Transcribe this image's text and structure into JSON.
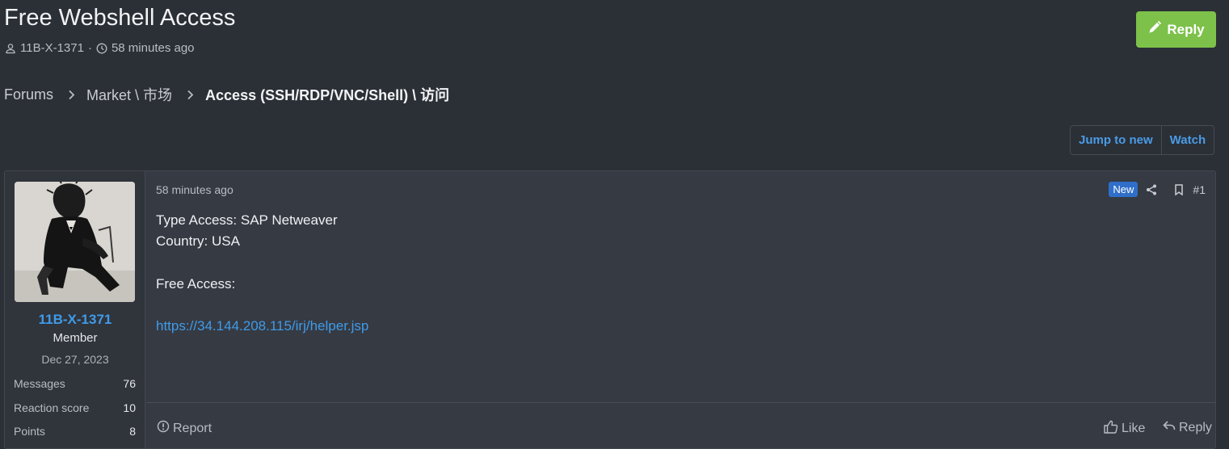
{
  "thread": {
    "title": "Free Webshell Access",
    "author": "11B-X-1371",
    "separator": "·",
    "time": "58 minutes ago",
    "reply_label": "Reply"
  },
  "breadcrumb": {
    "items": [
      "Forums",
      "Market \\ 市场"
    ],
    "current": "Access (SSH/RDP/VNC/Shell) \\ 访问"
  },
  "actions": {
    "jump_to_new": "Jump to new",
    "watch": "Watch"
  },
  "post": {
    "time": "58 minutes ago",
    "new_badge": "New",
    "number": "#1",
    "lines": [
      "Type Access: SAP Netweaver",
      "Country: USA",
      "Free Access:"
    ],
    "link": "https://34.144.208.115/irj/helper.jsp",
    "report": "Report",
    "like": "Like",
    "reply": "Reply"
  },
  "user": {
    "name": "11B-X-1371",
    "title": "Member",
    "joined": "Dec 27, 2023",
    "stats": [
      {
        "label": "Messages",
        "value": "76"
      },
      {
        "label": "Reaction score",
        "value": "10"
      },
      {
        "label": "Points",
        "value": "8"
      }
    ]
  },
  "colors": {
    "accent": "#3f9be8",
    "reply_button": "#7dc14a",
    "new_badge": "#2f6fc9"
  },
  "icons": [
    "user-icon",
    "clock-icon",
    "pencil-icon",
    "chevron-right-icon",
    "share-icon",
    "bookmark-icon",
    "report-icon",
    "like-icon",
    "reply-icon"
  ]
}
